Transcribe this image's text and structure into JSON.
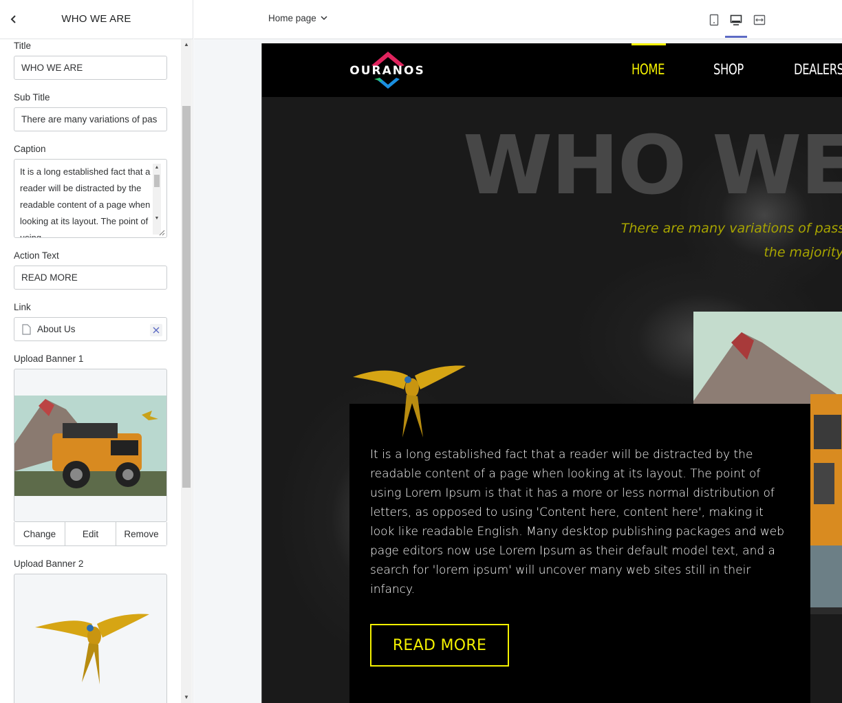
{
  "sidebar": {
    "title": "WHO WE ARE",
    "fields": {
      "title_label": "Title",
      "title_value": "WHO WE ARE",
      "subtitle_label": "Sub Title",
      "subtitle_value": "There are many variations of pas",
      "caption_label": "Caption",
      "caption_value": "It is a long established fact that a reader will be distracted by the readable content of a page when looking at its layout. The point of using",
      "action_text_label": "Action Text",
      "action_text_value": "READ MORE",
      "link_label": "Link",
      "link_value": "About Us",
      "banner1_label": "Upload Banner 1",
      "banner2_label": "Upload Banner 2"
    },
    "upload_actions": {
      "change": "Change",
      "edit": "Edit",
      "remove": "Remove"
    }
  },
  "toolbar": {
    "page_select": "Home page",
    "devices": [
      "mobile-icon",
      "desktop-icon",
      "fullwidth-icon"
    ],
    "active_device": "desktop"
  },
  "preview": {
    "logo": "OURANOS",
    "nav": [
      "HOME",
      "SHOP",
      "DEALERS"
    ],
    "active_nav": "HOME",
    "heading": "WHO WE",
    "subtitle_line1": "There are many variations of passages of Lorem",
    "subtitle_line2": "the majority have suffered",
    "caption": "It is a long established fact that a reader will be distracted by the readable content of a page when looking at its layout. The point of using Lorem Ipsum is that it has a more or less normal distribution of letters, as opposed to using 'Content here, content here', making it look like readable English. Many desktop publishing packages and web page editors now use Lorem Ipsum as their default model text, and a search for 'lorem ipsum' will uncover many web sites still in their infancy.",
    "button": "READ MORE"
  },
  "colors": {
    "accent_yellow": "#f4f100",
    "subtitle_olive": "#a7a400",
    "heading_gray": "#474747",
    "active_tab": "#5c6ac4"
  }
}
